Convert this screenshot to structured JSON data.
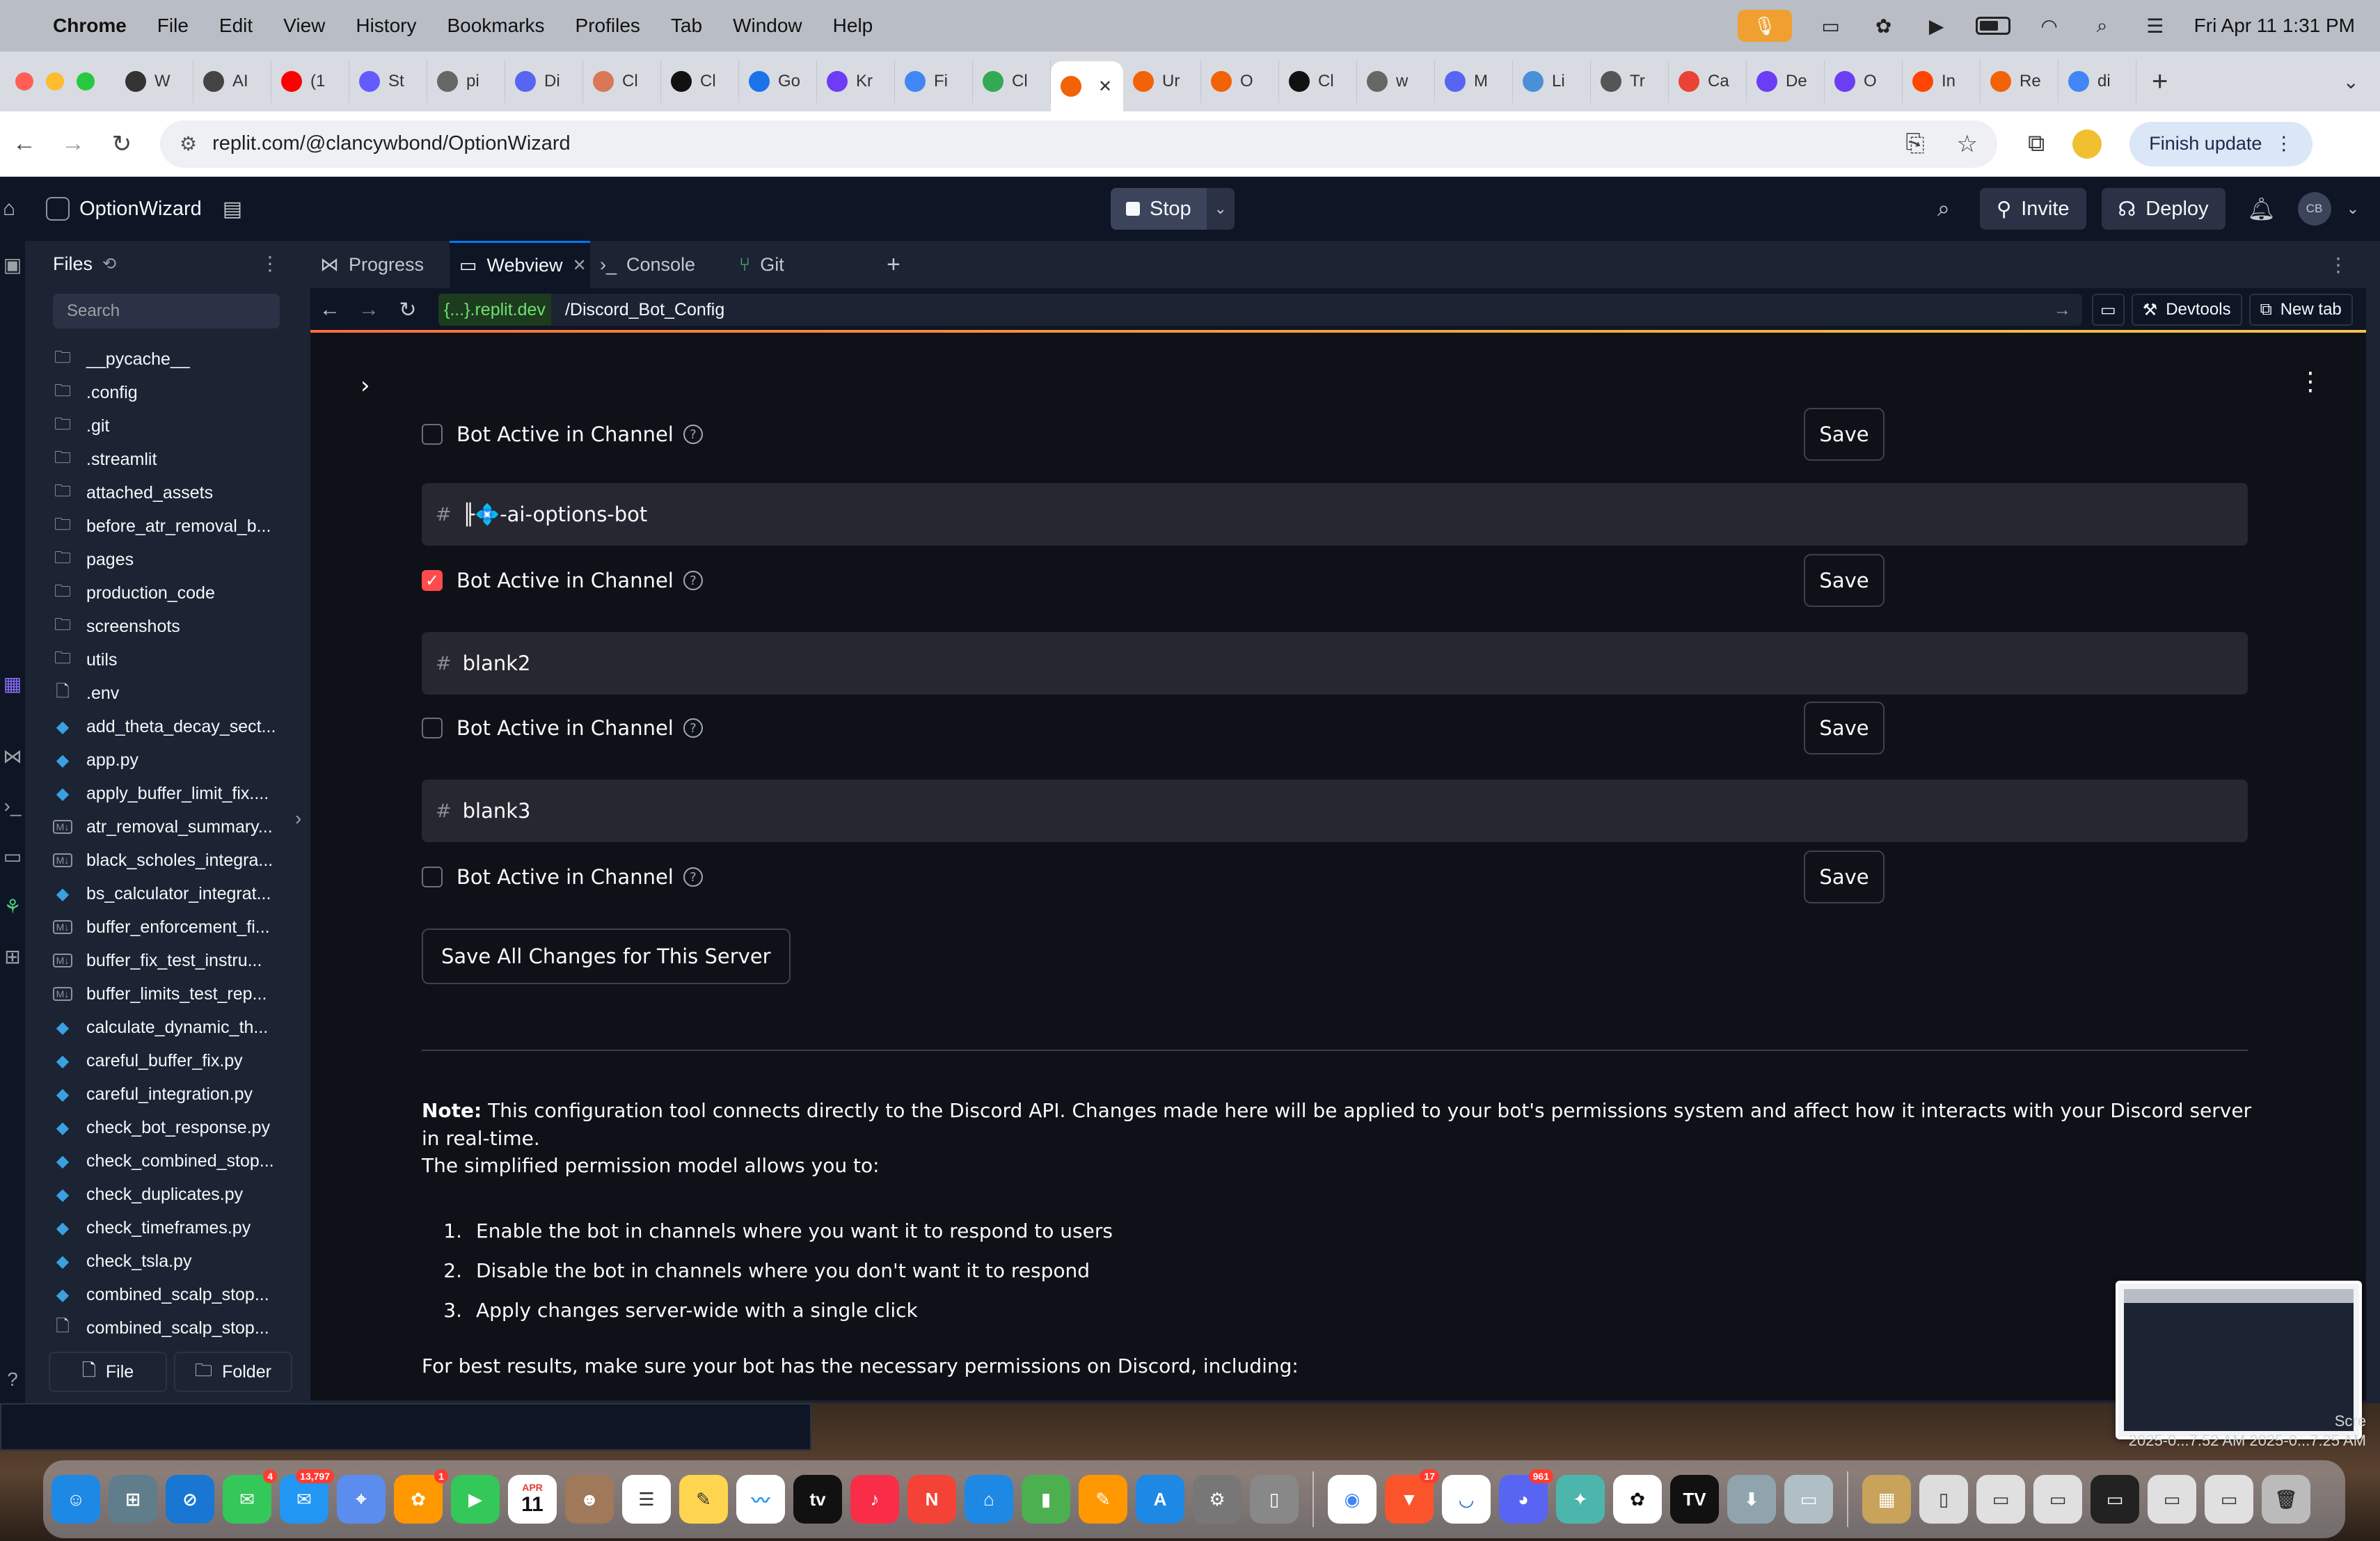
{
  "menubar": {
    "app_name": "Chrome",
    "menus": [
      "File",
      "Edit",
      "View",
      "History",
      "Bookmarks",
      "Profiles",
      "Tab",
      "Window",
      "Help"
    ],
    "datetime": "Fri Apr 11  1:31 PM"
  },
  "browser": {
    "tabs": [
      {
        "label": "W",
        "color": "#333333"
      },
      {
        "label": "AI",
        "color": "#444444"
      },
      {
        "label": "(1",
        "color": "#ff0000"
      },
      {
        "label": "St",
        "color": "#635bff"
      },
      {
        "label": "pi",
        "color": "#666666"
      },
      {
        "label": "Di",
        "color": "#5865f2"
      },
      {
        "label": "Cl",
        "color": "#d97757"
      },
      {
        "label": "Cl",
        "color": "#111111"
      },
      {
        "label": "Go",
        "color": "#1a73e8"
      },
      {
        "label": "Kr",
        "color": "#6e3cf5"
      },
      {
        "label": "Fi",
        "color": "#4285f4"
      },
      {
        "label": "Cl",
        "color": "#34a853"
      },
      {
        "label": "",
        "color": "#f26207",
        "active": true
      },
      {
        "label": "Ur",
        "color": "#f26207"
      },
      {
        "label": "O",
        "color": "#f26207"
      },
      {
        "label": "Cl",
        "color": "#111111"
      },
      {
        "label": "w",
        "color": "#666666"
      },
      {
        "label": "M",
        "color": "#5865f2"
      },
      {
        "label": "Li",
        "color": "#4a90d9"
      },
      {
        "label": "Tr",
        "color": "#555555"
      },
      {
        "label": "Ca",
        "color": "#ea4335"
      },
      {
        "label": "De",
        "color": "#6b3df5"
      },
      {
        "label": "O",
        "color": "#6b3df5"
      },
      {
        "label": "In",
        "color": "#ff4500"
      },
      {
        "label": "Re",
        "color": "#f26207"
      },
      {
        "label": "di",
        "color": "#4285f4"
      }
    ],
    "url": "replit.com/@clancywbond/OptionWizard",
    "finish_update": "Finish update"
  },
  "replit": {
    "project_name": "OptionWizard",
    "stop_label": "Stop",
    "invite_label": "Invite",
    "deploy_label": "Deploy",
    "avatar_initials": "CB",
    "files": {
      "title": "Files",
      "search_placeholder": "Search",
      "items": [
        {
          "name": "__pycache__",
          "type": "folder"
        },
        {
          "name": ".config",
          "type": "folder"
        },
        {
          "name": ".git",
          "type": "folder"
        },
        {
          "name": ".streamlit",
          "type": "folder"
        },
        {
          "name": "attached_assets",
          "type": "folder"
        },
        {
          "name": "before_atr_removal_b...",
          "type": "folder"
        },
        {
          "name": "pages",
          "type": "folder"
        },
        {
          "name": "production_code",
          "type": "folder"
        },
        {
          "name": "screenshots",
          "type": "folder"
        },
        {
          "name": "utils",
          "type": "folder"
        },
        {
          "name": ".env",
          "type": "file"
        },
        {
          "name": "add_theta_decay_sect...",
          "type": "py"
        },
        {
          "name": "app.py",
          "type": "py"
        },
        {
          "name": "apply_buffer_limit_fix....",
          "type": "py"
        },
        {
          "name": "atr_removal_summary...",
          "type": "md"
        },
        {
          "name": "black_scholes_integra...",
          "type": "md"
        },
        {
          "name": "bs_calculator_integrat...",
          "type": "py"
        },
        {
          "name": "buffer_enforcement_fi...",
          "type": "md"
        },
        {
          "name": "buffer_fix_test_instru...",
          "type": "md"
        },
        {
          "name": "buffer_limits_test_rep...",
          "type": "md"
        },
        {
          "name": "calculate_dynamic_th...",
          "type": "py"
        },
        {
          "name": "careful_buffer_fix.py",
          "type": "py"
        },
        {
          "name": "careful_integration.py",
          "type": "py"
        },
        {
          "name": "check_bot_response.py",
          "type": "py"
        },
        {
          "name": "check_combined_stop...",
          "type": "py"
        },
        {
          "name": "check_duplicates.py",
          "type": "py"
        },
        {
          "name": "check_timeframes.py",
          "type": "py"
        },
        {
          "name": "check_tsla.py",
          "type": "py"
        },
        {
          "name": "combined_scalp_stop...",
          "type": "py"
        },
        {
          "name": "combined_scalp_stop...",
          "type": "file"
        }
      ],
      "new_file_label": "File",
      "new_folder_label": "Folder"
    },
    "workspace_tabs": [
      {
        "label": "Progress",
        "icon": "progress-icon"
      },
      {
        "label": "Webview",
        "icon": "monitor-icon",
        "active": true
      },
      {
        "label": "Console",
        "icon": "terminal-icon"
      },
      {
        "label": "Git",
        "icon": "git-icon"
      }
    ],
    "webview": {
      "domain": "{...}.replit.dev",
      "path": "/Discord_Bot_Config",
      "devtools_label": "Devtools",
      "new_tab_label": "New tab"
    }
  },
  "app": {
    "checkbox_label": "Bot Active in Channel",
    "save_label": "Save",
    "rows": [
      {
        "channel": null,
        "checked": false
      },
      {
        "channel": "╟💠-ai-options-bot",
        "checked": true
      },
      {
        "channel": "blank2",
        "checked": false
      },
      {
        "channel": "blank3",
        "checked": false
      }
    ],
    "save_all_label": "Save All Changes for This Server",
    "note_bold": "Note:",
    "note_text": " This configuration tool connects directly to the Discord API. Changes made here will be applied to your bot's permissions system and affect how it interacts with your Discord server in real-time.",
    "model_intro": "The simplified permission model allows you to:",
    "model_items": [
      "Enable the bot in channels where you want it to respond to users",
      "Disable the bot in channels where you don't want it to respond",
      "Apply changes server-wide with a single click"
    ],
    "best_results": "For best results, make sure your bot has the necessary permissions on Discord, including:"
  },
  "screenshot_thumb": {
    "caption_line1": "Scre",
    "caption_line2": "2025-0...7.52 AM   2025-0...7.25 AM"
  },
  "dock": {
    "badges": {
      "messages": "4",
      "mail": "13,797",
      "photos": "1",
      "calendar_month": "APR",
      "calendar_day": "11",
      "brave": "17",
      "discord": "961"
    }
  }
}
